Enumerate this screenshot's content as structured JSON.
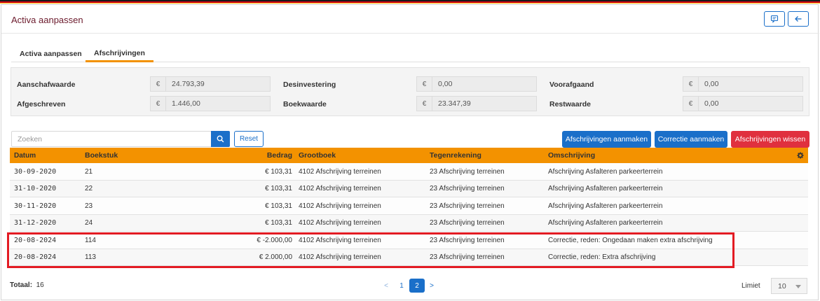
{
  "header": {
    "title": "Activa aanpassen"
  },
  "tabs": [
    {
      "label": "Activa aanpassen",
      "active": false
    },
    {
      "label": "Afschrijvingen",
      "active": true
    }
  ],
  "summary": {
    "aanschafwaarde": {
      "label": "Aanschafwaarde",
      "currency": "€",
      "value": "24.793,39"
    },
    "desinvestering": {
      "label": "Desinvestering",
      "currency": "€",
      "value": "0,00"
    },
    "voorafgaand": {
      "label": "Voorafgaand",
      "currency": "€",
      "value": "0,00"
    },
    "afgeschreven": {
      "label": "Afgeschreven",
      "currency": "€",
      "value": "1.446,00"
    },
    "boekwaarde": {
      "label": "Boekwaarde",
      "currency": "€",
      "value": "23.347,39"
    },
    "restwaarde": {
      "label": "Restwaarde",
      "currency": "€",
      "value": "0,00"
    }
  },
  "search": {
    "placeholder": "Zoeken",
    "reset_label": "Reset"
  },
  "actions": {
    "aanmaken": "Afschrijvingen aanmaken",
    "correctie": "Correctie aanmaken",
    "wissen": "Afschrijvingen wissen"
  },
  "table": {
    "headers": {
      "datum": "Datum",
      "boekstuk": "Boekstuk",
      "bedrag": "Bedrag",
      "grootboek": "Grootboek",
      "tegenrekening": "Tegenrekening",
      "omschrijving": "Omschrijving"
    },
    "rows": [
      {
        "datum": "30-09-2020",
        "boekstuk": "21",
        "bedrag": "€ 103,31",
        "grootboek": "4102 Afschrijving terreinen",
        "tegenrekening": "23 Afschrijving terreinen",
        "omschrijving": "Afschrijving Asfalteren parkeerterrein"
      },
      {
        "datum": "31-10-2020",
        "boekstuk": "22",
        "bedrag": "€ 103,31",
        "grootboek": "4102 Afschrijving terreinen",
        "tegenrekening": "23 Afschrijving terreinen",
        "omschrijving": "Afschrijving Asfalteren parkeerterrein"
      },
      {
        "datum": "30-11-2020",
        "boekstuk": "23",
        "bedrag": "€ 103,31",
        "grootboek": "4102 Afschrijving terreinen",
        "tegenrekening": "23 Afschrijving terreinen",
        "omschrijving": "Afschrijving Asfalteren parkeerterrein"
      },
      {
        "datum": "31-12-2020",
        "boekstuk": "24",
        "bedrag": "€ 103,31",
        "grootboek": "4102 Afschrijving terreinen",
        "tegenrekening": "23 Afschrijving terreinen",
        "omschrijving": "Afschrijving Asfalteren parkeerterrein"
      },
      {
        "datum": "20-08-2024",
        "boekstuk": "114",
        "bedrag": "€ -2.000,00",
        "grootboek": "4102 Afschrijving terreinen",
        "tegenrekening": "23 Afschrijving terreinen",
        "omschrijving": "Correctie, reden: Ongedaan maken extra afschrijving"
      },
      {
        "datum": "20-08-2024",
        "boekstuk": "113",
        "bedrag": "€ 2.000,00",
        "grootboek": "4102 Afschrijving terreinen",
        "tegenrekening": "23 Afschrijving terreinen",
        "omschrijving": "Correctie, reden: Extra afschrijving"
      }
    ]
  },
  "footer": {
    "totaal_label": "Totaal:",
    "totaal_value": "16",
    "pages": {
      "prev": "<",
      "p1": "1",
      "p2": "2",
      "next": ">"
    },
    "current_page": "2",
    "limiet_label": "Limiet",
    "limiet_value": "10"
  },
  "colors": {
    "accent": "#f39200",
    "primary": "#1a6fc9",
    "danger": "#e0303e",
    "title": "#6b1a2c",
    "highlight": "#e31b23"
  }
}
